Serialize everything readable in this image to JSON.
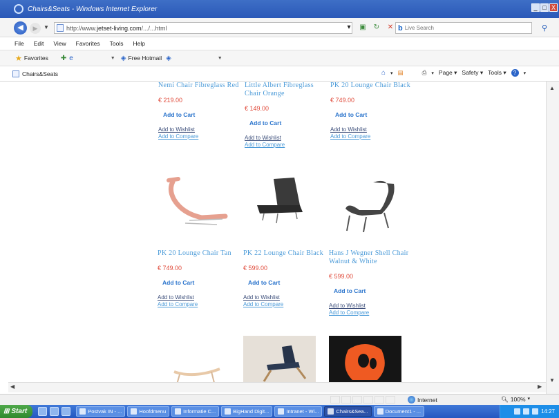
{
  "window": {
    "title": "Chairs&Seats - Windows Internet Explorer",
    "controls": [
      "_",
      "□",
      "X"
    ]
  },
  "address": {
    "url_prefix": "http://www.",
    "url_domain": "jetset-living.com",
    "url_suffix": "/.../...html",
    "search_placeholder": "Live Search"
  },
  "menu": [
    "File",
    "Edit",
    "View",
    "Favorites",
    "Tools",
    "Help"
  ],
  "favorites": {
    "label": "Favorites",
    "hotmail": "Free Hotmail"
  },
  "tab": {
    "label": "Chairs&Seats"
  },
  "commands": {
    "page": "Page",
    "safety": "Safety",
    "tools": "Tools"
  },
  "products": [
    {
      "name": "Nemi Chair Fibreglass Red",
      "price": "€ 219.00",
      "cart": "Add to Cart",
      "wishlist": "Add to Wishlist",
      "compare": "Add to Compare"
    },
    {
      "name": "Little Albert Fibreglass Chair Orange",
      "price": "€ 149.00",
      "cart": "Add to Cart",
      "wishlist": "Add to Wishlist",
      "compare": "Add to Compare"
    },
    {
      "name": "PK 20 Lounge Chair Black",
      "price": "€ 749.00",
      "cart": "Add to Cart",
      "wishlist": "Add to Wishlist",
      "compare": "Add to Compare"
    },
    {
      "name": "PK 20 Lounge Chair Tan",
      "price": "€ 749.00",
      "cart": "Add to Cart",
      "wishlist": "Add to Wishlist",
      "compare": "Add to Compare"
    },
    {
      "name": "PK 22 Lounge Chair Black",
      "price": "€ 599.00",
      "cart": "Add to Cart",
      "wishlist": "Add to Wishlist",
      "compare": "Add to Compare"
    },
    {
      "name": "Hans J Wegner Shell Chair Walnut & White",
      "price": "€ 599.00",
      "cart": "Add to Cart",
      "wishlist": "Add to Wishlist",
      "compare": "Add to Compare"
    }
  ],
  "status": {
    "zone": "Internet",
    "zoom": "100%"
  },
  "taskbar": {
    "start": "Start",
    "items": [
      "Postvak IN - ...",
      "Hoofdmenu",
      "Informatie C...",
      "BigHand Digit...",
      "Intranet - Wi...",
      "Chairs&Sea...",
      "Document1 - ..."
    ],
    "clock": "14:27"
  },
  "colors": {
    "title_bar": "#2a58b8",
    "link": "#4a9ad8",
    "price": "#e04a3a",
    "taskbar": "#2457c0",
    "start": "#2f8a2d"
  }
}
